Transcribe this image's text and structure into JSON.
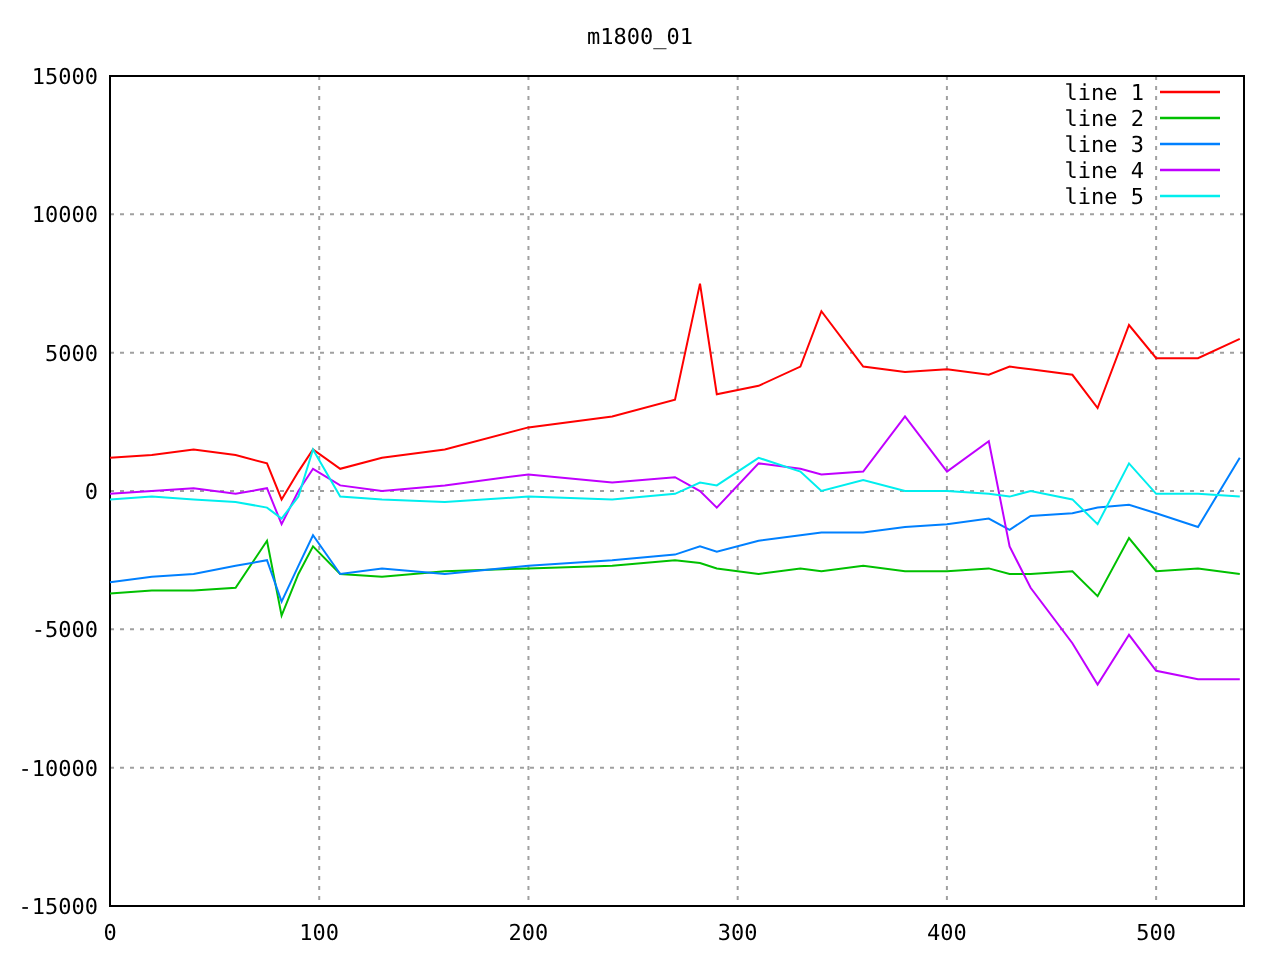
{
  "chart_data": {
    "type": "line",
    "title": "m1800_01",
    "grid": true,
    "legend": true,
    "xlim": [
      0,
      542
    ],
    "ylim": [
      -15000,
      15000
    ],
    "xticks": [
      0,
      100,
      200,
      300,
      400,
      500
    ],
    "yticks": [
      -15000,
      -10000,
      -5000,
      0,
      5000,
      10000,
      15000
    ],
    "x": [
      0,
      20,
      40,
      60,
      75,
      82,
      90,
      97,
      110,
      130,
      160,
      200,
      240,
      270,
      282,
      290,
      310,
      330,
      340,
      360,
      380,
      400,
      420,
      430,
      440,
      460,
      472,
      487,
      500,
      520,
      540
    ],
    "series": [
      {
        "name": "line 1",
        "color": "#ff0000",
        "values": [
          1200,
          1300,
          1500,
          1300,
          1000,
          -300,
          700,
          1500,
          800,
          1200,
          1500,
          2300,
          2700,
          3300,
          7500,
          3500,
          3800,
          4500,
          6500,
          4500,
          4300,
          4400,
          4200,
          4500,
          4400,
          4200,
          3000,
          6000,
          4800,
          4800,
          5500
        ]
      },
      {
        "name": "line 2",
        "color": "#00c000",
        "values": [
          -3700,
          -3600,
          -3600,
          -3500,
          -1800,
          -4500,
          -3000,
          -2000,
          -3000,
          -3100,
          -2900,
          -2800,
          -2700,
          -2500,
          -2600,
          -2800,
          -3000,
          -2800,
          -2900,
          -2700,
          -2900,
          -2900,
          -2800,
          -3000,
          -3000,
          -2900,
          -3800,
          -1700,
          -2900,
          -2800,
          -3000
        ]
      },
      {
        "name": "line 3",
        "color": "#0080ff",
        "values": [
          -3300,
          -3100,
          -3000,
          -2700,
          -2500,
          -4000,
          -2700,
          -1600,
          -3000,
          -2800,
          -3000,
          -2700,
          -2500,
          -2300,
          -2000,
          -2200,
          -1800,
          -1600,
          -1500,
          -1500,
          -1300,
          -1200,
          -1000,
          -1400,
          -900,
          -800,
          -600,
          -500,
          -800,
          -1300,
          1200
        ]
      },
      {
        "name": "line 4",
        "color": "#c000ff",
        "values": [
          -100,
          0,
          100,
          -100,
          100,
          -1200,
          0,
          800,
          200,
          0,
          200,
          600,
          300,
          500,
          0,
          -600,
          1000,
          800,
          600,
          700,
          2700,
          700,
          1800,
          -2000,
          -3500,
          -5500,
          -7000,
          -5200,
          -6500,
          -6800,
          -6800
        ]
      },
      {
        "name": "line 5",
        "color": "#00eeee",
        "values": [
          -300,
          -200,
          -300,
          -400,
          -600,
          -1000,
          -200,
          1500,
          -200,
          -300,
          -400,
          -200,
          -300,
          -100,
          300,
          200,
          1200,
          700,
          0,
          400,
          0,
          0,
          -100,
          -200,
          0,
          -300,
          -1200,
          1000,
          -100,
          -100,
          -200
        ]
      }
    ]
  }
}
